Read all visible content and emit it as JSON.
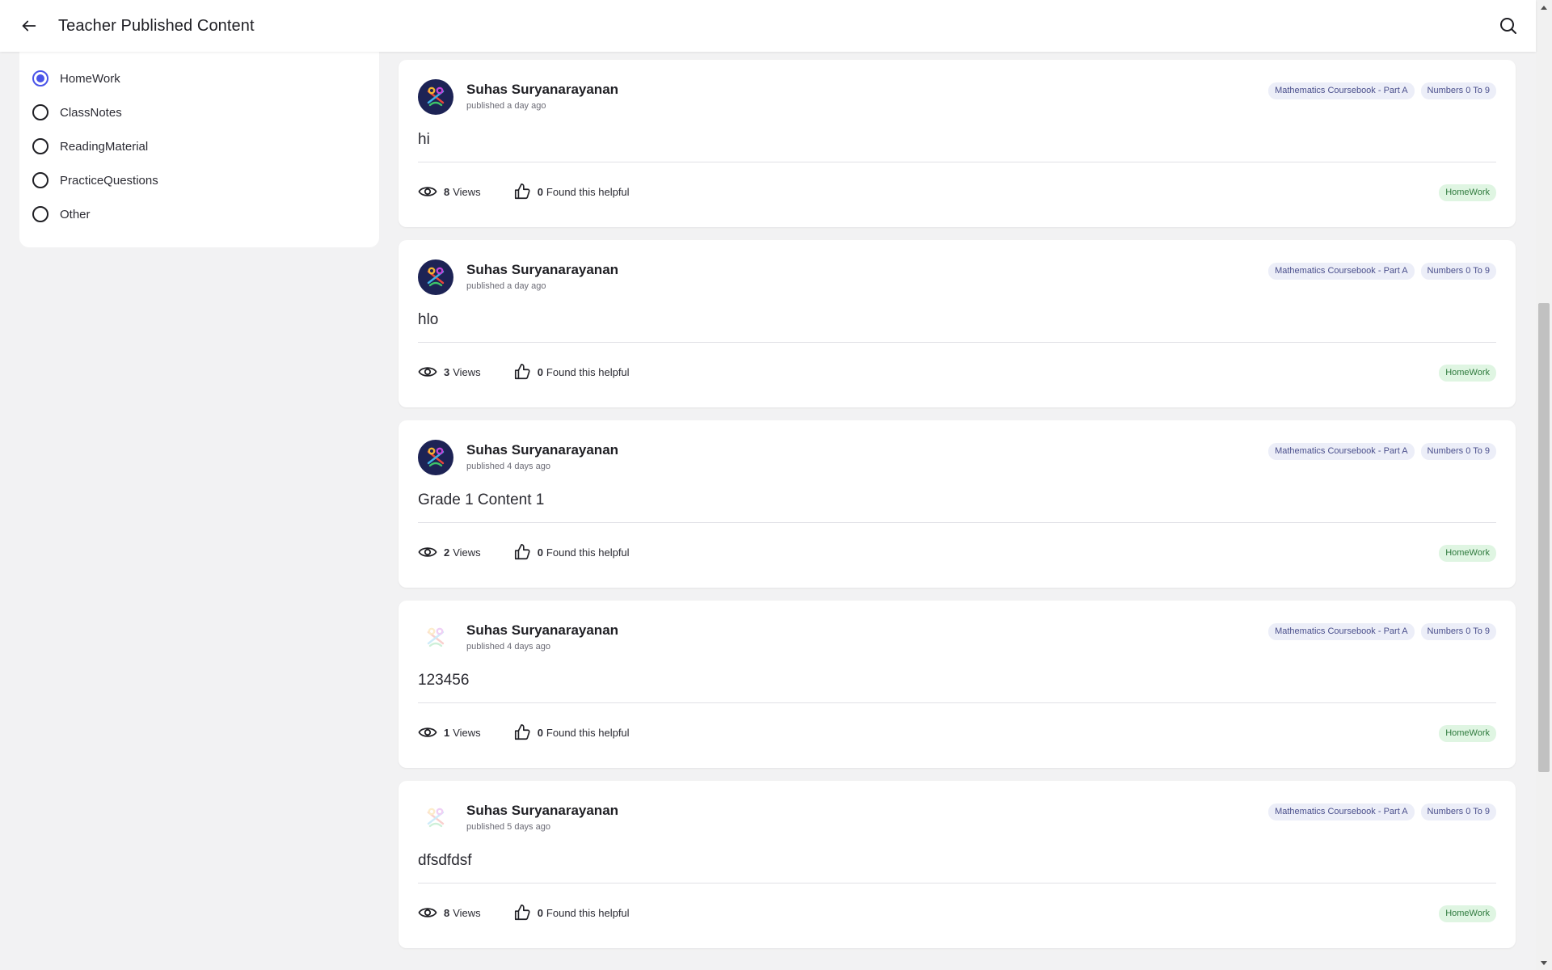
{
  "header": {
    "title": "Teacher Published Content"
  },
  "filters": {
    "options": [
      {
        "label": "HomeWork",
        "selected": true
      },
      {
        "label": "ClassNotes",
        "selected": false
      },
      {
        "label": "ReadingMaterial",
        "selected": false
      },
      {
        "label": "PracticeQuestions",
        "selected": false
      },
      {
        "label": "Other",
        "selected": false
      }
    ]
  },
  "posts": [
    {
      "author": "Suhas Suryanarayanan",
      "published": "published a day ago",
      "body": "hi",
      "tags": [
        "Mathematics Coursebook - Part A",
        "Numbers 0 To 9"
      ],
      "views": "8",
      "views_label": "Views",
      "helpful": "0",
      "helpful_label": "Found this helpful",
      "type": "HomeWork",
      "avatar": "dark"
    },
    {
      "author": "Suhas Suryanarayanan",
      "published": "published a day ago",
      "body": "hlo",
      "tags": [
        "Mathematics Coursebook - Part A",
        "Numbers 0 To 9"
      ],
      "views": "3",
      "views_label": "Views",
      "helpful": "0",
      "helpful_label": "Found this helpful",
      "type": "HomeWork",
      "avatar": "dark"
    },
    {
      "author": "Suhas Suryanarayanan",
      "published": "published 4 days ago",
      "body": "Grade 1 Content 1",
      "tags": [
        "Mathematics Coursebook - Part A",
        "Numbers 0 To 9"
      ],
      "views": "2",
      "views_label": "Views",
      "helpful": "0",
      "helpful_label": "Found this helpful",
      "type": "HomeWork",
      "avatar": "dark"
    },
    {
      "author": "Suhas Suryanarayanan",
      "published": "published 4 days ago",
      "body": "123456",
      "tags": [
        "Mathematics Coursebook - Part A",
        "Numbers 0 To 9"
      ],
      "views": "1",
      "views_label": "Views",
      "helpful": "0",
      "helpful_label": "Found this helpful",
      "type": "HomeWork",
      "avatar": "faded"
    },
    {
      "author": "Suhas Suryanarayanan",
      "published": "published 5 days ago",
      "body": "dfsdfdsf",
      "tags": [
        "Mathematics Coursebook - Part A",
        "Numbers 0 To 9"
      ],
      "views": "8",
      "views_label": "Views",
      "helpful": "0",
      "helpful_label": "Found this helpful",
      "type": "HomeWork",
      "avatar": "faded"
    }
  ],
  "icons": {
    "back": "arrow-left-icon",
    "search": "search-icon",
    "views": "eye-icon",
    "helpful": "thumbs-up-icon",
    "avatar": "logo-icon"
  },
  "colors": {
    "accent": "#4a54e8",
    "tag_bg": "#eceef8",
    "tag_text": "#4a4f8c",
    "badge_bg": "#dff5e2",
    "badge_text": "#2f7a3e"
  }
}
